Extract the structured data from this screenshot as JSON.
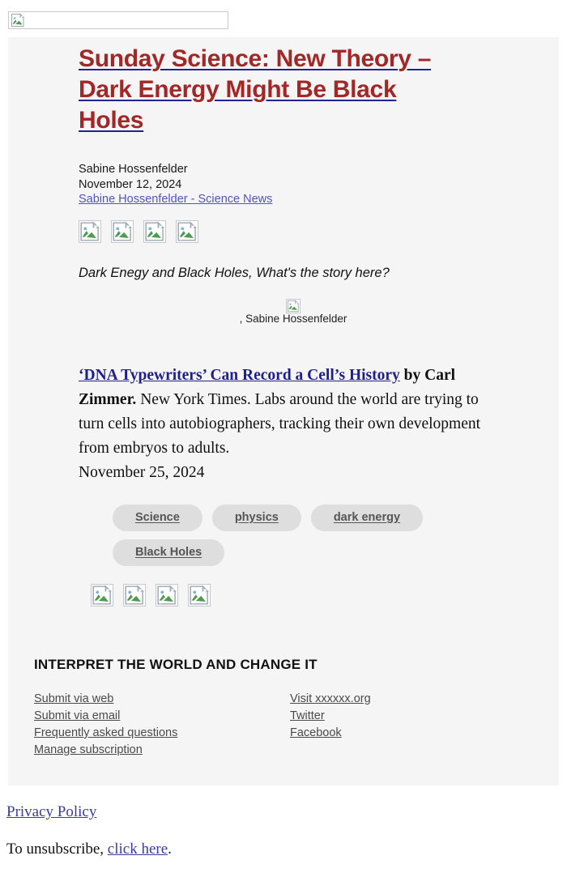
{
  "banner": {
    "icon": "broken-image-icon",
    "alt": ""
  },
  "article": {
    "headline": "Sunday Science: New Theory – Dark Energy Might Be Black Holes",
    "author": "Sabine Hossenfelder",
    "date": "November 12, 2024",
    "source_link": "Sabine Hossenfelder - Science News",
    "subhead": "Dark Enegy and Black Holes, What's the story here?",
    "figure_caption": ", Sabine Hossenfelder",
    "figure_icon": "broken-image-icon",
    "social_icons_top": [
      "broken-image-icon",
      "broken-image-icon",
      "broken-image-icon",
      "broken-image-icon"
    ],
    "social_icons_bottom": [
      "broken-image-icon",
      "broken-image-icon",
      "broken-image-icon",
      "broken-image-icon"
    ]
  },
  "story": {
    "link_text": "‘DNA Typewriters’ Can Record a Cell’s History",
    "by_word": " by ",
    "author_bold": "Carl Zimmer.",
    "body": " New York Times. Labs around the world are trying to turn cells into autobiographers, tracking their own development from embryos to adults.",
    "date": "November 25, 2024"
  },
  "tags": [
    {
      "label": "Science"
    },
    {
      "label": "physics"
    },
    {
      "label": "dark energy"
    },
    {
      "label": "Black Holes"
    }
  ],
  "footer": {
    "title": "INTERPRET THE WORLD AND CHANGE IT",
    "left_links": [
      {
        "label": "Submit via web"
      },
      {
        "label": "Submit via email"
      },
      {
        "label": "Frequently asked questions"
      },
      {
        "label": "Manage subscription"
      }
    ],
    "right_links": [
      {
        "label": "Visit xxxxxx.org"
      },
      {
        "label": "Twitter"
      },
      {
        "label": "Facebook"
      }
    ]
  },
  "bottom": {
    "privacy_policy": "Privacy Policy",
    "unsubscribe_prefix": "To unsubscribe, ",
    "unsubscribe_link": "click here",
    "unsubscribe_suffix": "."
  },
  "colors": {
    "headline": "#a32727",
    "headline_underline": "#24248f",
    "panel_bg": "#f5f5f5",
    "page_bg": "#ffffff",
    "story_link": "#1f1f8c",
    "footer_link": "#4a4a4a",
    "tag_bg": "#dedede",
    "tag_text": "#555555",
    "bottom_link": "#3b3b9e"
  }
}
